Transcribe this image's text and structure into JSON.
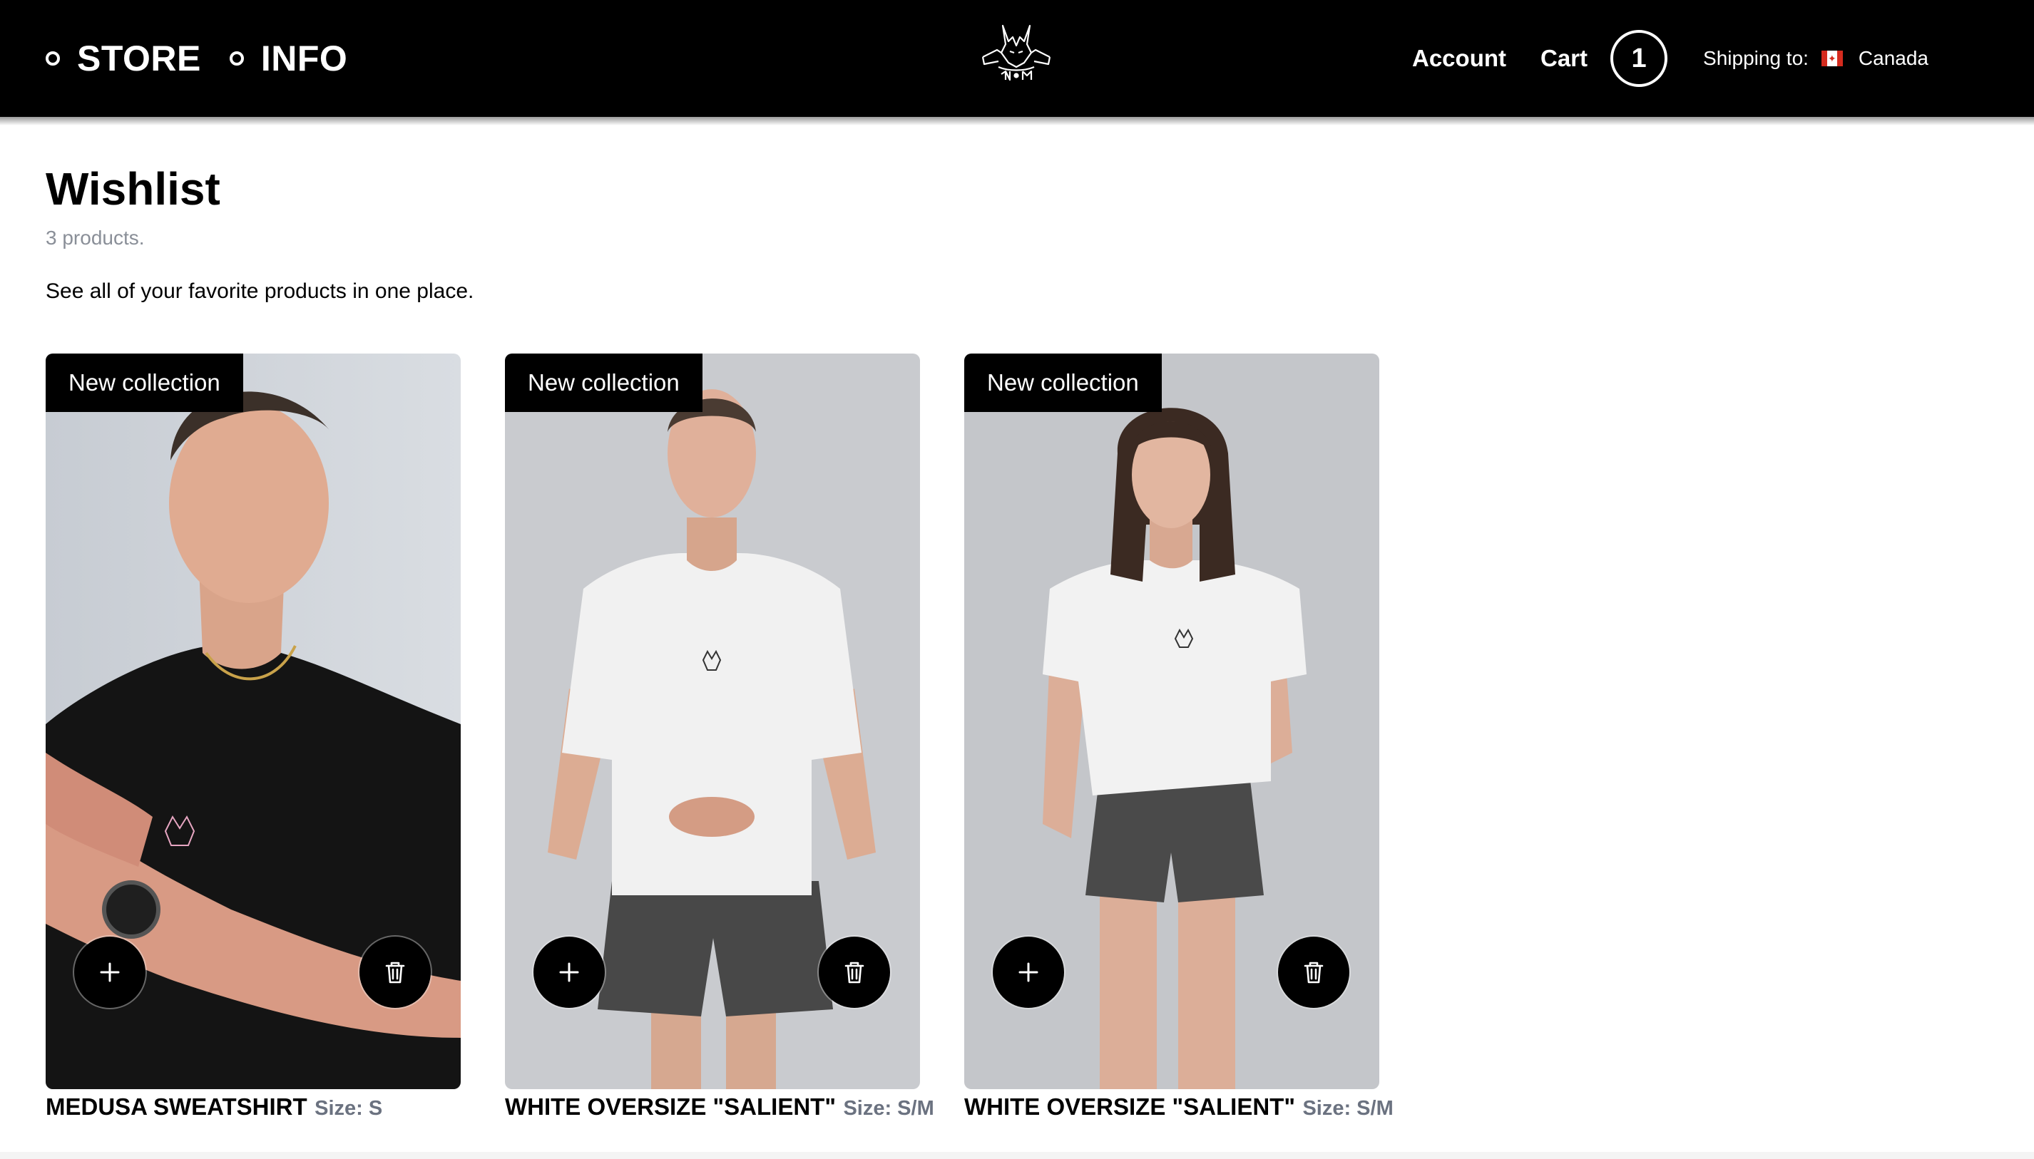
{
  "header": {
    "nav_left": [
      {
        "label": "STORE"
      },
      {
        "label": "INFO"
      }
    ],
    "logo_icon": "doberman-logo-icon",
    "account_label": "Account",
    "cart_label": "Cart",
    "cart_count": "1",
    "shipping_label": "Shipping to:",
    "shipping_country": "Canada",
    "flag_icon": "canada-flag-icon"
  },
  "page": {
    "title": "Wishlist",
    "product_count": "3 products.",
    "description": "See all of your favorite products in one place."
  },
  "products": [
    {
      "badge": "New collection",
      "name": "MEDUSA SWEATSHIRT",
      "size": "Size: S",
      "image": "man in black t-shirt"
    },
    {
      "badge": "New collection",
      "name": "WHITE OVERSIZE \"SALIENT\"",
      "size": "Size: S/M",
      "image": "man in white t-shirt"
    },
    {
      "badge": "New collection",
      "name": "WHITE OVERSIZE \"SALIENT\"",
      "size": "Size: S/M",
      "image": "woman in white t-shirt"
    }
  ],
  "icons": {
    "add": "plus-icon",
    "remove": "trash-icon"
  },
  "colors": {
    "header_bg": "#000000",
    "badge_bg": "#000000",
    "muted_text": "#8a8f98",
    "size_text": "#6b7280"
  }
}
